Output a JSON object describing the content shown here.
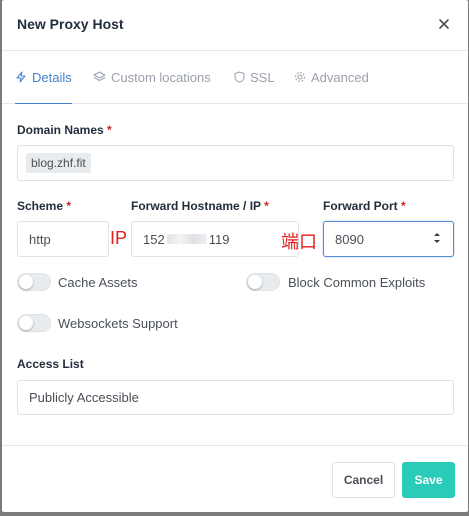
{
  "dialog": {
    "title": "New Proxy Host"
  },
  "tabs": [
    {
      "label": "Details",
      "icon": "zap-icon"
    },
    {
      "label": "Custom locations",
      "icon": "layers-icon"
    },
    {
      "label": "SSL",
      "icon": "shield-icon"
    },
    {
      "label": "Advanced",
      "icon": "gear-icon"
    }
  ],
  "form": {
    "domain_names_label": "Domain Names",
    "domain_tag": "blog.zhf.fit",
    "required_mark": "*",
    "scheme_label": "Scheme",
    "scheme_value": "http",
    "hostname_label": "Forward Hostname / IP",
    "hostname_prefix": "152",
    "hostname_suffix": "119",
    "port_label": "Forward Port",
    "port_value": "8090",
    "annotation_ip": "IP",
    "annotation_port": "端口",
    "cache_assets": "Cache Assets",
    "block_exploits": "Block Common Exploits",
    "websockets": "Websockets Support",
    "access_list_label": "Access List",
    "access_list_value": "Publicly Accessible"
  },
  "footer": {
    "cancel": "Cancel",
    "save": "Save"
  },
  "colors": {
    "accent": "#467fcf",
    "save": "#2bcbba",
    "required": "#cd201f",
    "annotation": "#e21d1d"
  }
}
